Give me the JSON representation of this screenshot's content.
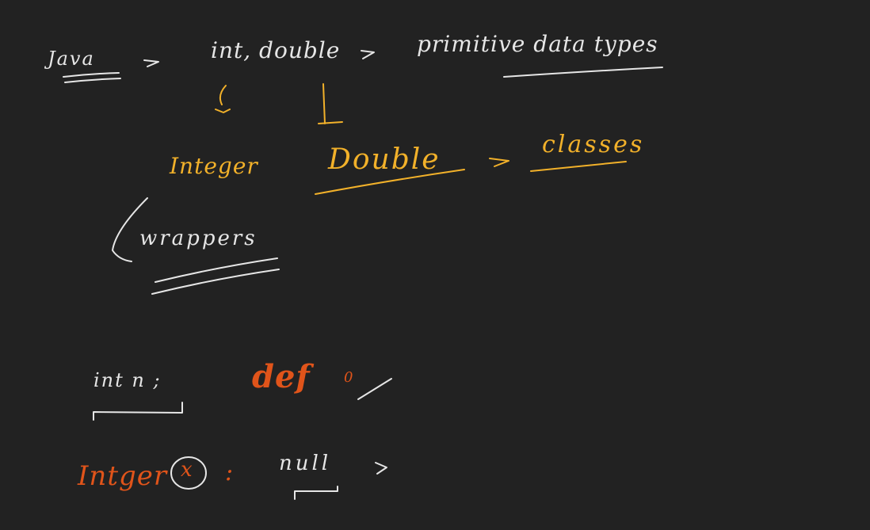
{
  "notes": {
    "java": "Java",
    "arrow": "→",
    "primitives_list": "int, double",
    "primitive_data_types": "primitive data types",
    "integer_class": "Integer",
    "double_class": "Double",
    "classes": "classes",
    "wrappers": "wrappers",
    "int_decl": "int n ;",
    "default_label": "def",
    "default_value": "0",
    "integer_decl": "Intger",
    "integer_var": "x",
    "colon": ":",
    "null_value": "null"
  },
  "colors": {
    "background": "#222222",
    "white_ink": "#e6e6e6",
    "yellow_ink": "#f2b12a",
    "orange_ink": "#e0541a"
  }
}
